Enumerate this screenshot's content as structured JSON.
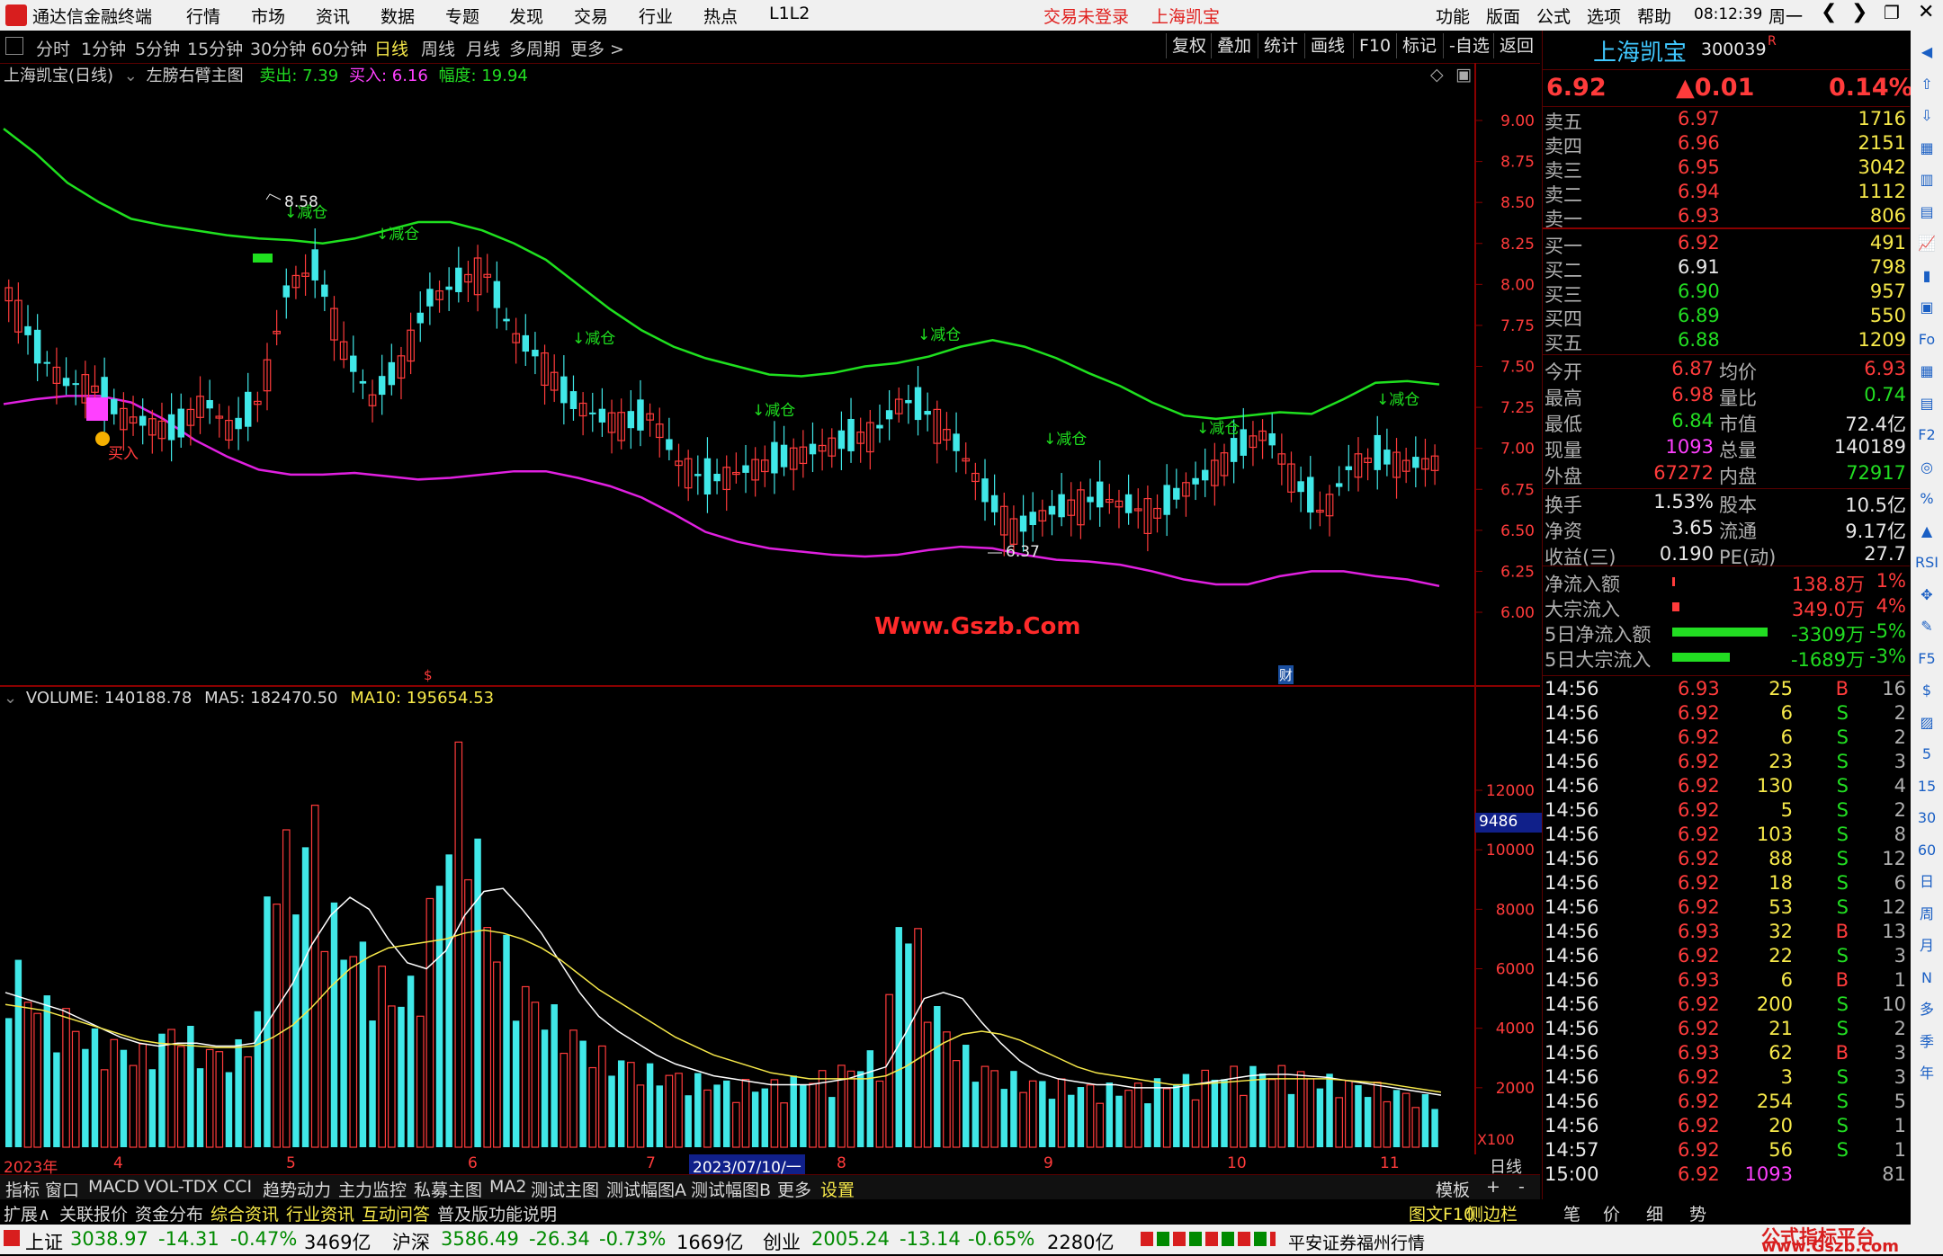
{
  "titlebar": {
    "app_title": "通达信金融终端",
    "menus": [
      "行情",
      "市场",
      "资讯",
      "数据",
      "专题",
      "发现",
      "交易",
      "行业",
      "热点",
      "L1L2"
    ],
    "login_status": "交易未登录",
    "stock_name": "上海凯宝",
    "right_menus": [
      "功能",
      "版面",
      "公式",
      "选项",
      "帮助"
    ],
    "clock": "08:12:39",
    "weekday": "周一"
  },
  "toolbar": {
    "periods": [
      "分时",
      "1分钟",
      "5分钟",
      "15分钟",
      "30分钟",
      "60分钟",
      "日线",
      "周线",
      "月线",
      "多周期",
      "更多 >"
    ],
    "selected": "日线",
    "buttons": [
      "复权",
      "叠加",
      "统计",
      "画线",
      "F10",
      "标记",
      "-自选",
      "返回"
    ]
  },
  "main_header": {
    "name": "上海凯宝(日线)",
    "formula": "左膀右臂主图",
    "sell_label": "卖出: 7.39",
    "buy_label": "买入: 6.16",
    "range_label": "幅度: 19.94"
  },
  "main_chart": {
    "y_ticks": [
      "9.00",
      "8.75",
      "8.50",
      "8.25",
      "8.00",
      "7.75",
      "7.50",
      "7.25",
      "7.00",
      "6.75",
      "6.50",
      "6.25",
      "6.00"
    ],
    "annotations": {
      "high": "8.58",
      "low": "6.37",
      "reduce": "减仓",
      "buy": "买入",
      "watermark": "Www.Gszb.Com",
      "dollar": "$",
      "fin": "财"
    }
  },
  "volume_header": {
    "volume": "VOLUME: 140188.78",
    "ma5": "MA5: 182470.50",
    "ma10": "MA10: 195654.53"
  },
  "volume_chart": {
    "y_ticks": [
      "12000",
      "10000",
      "8000",
      "6000",
      "4000",
      "2000"
    ],
    "cursor_value": "9486",
    "unit": "X100"
  },
  "x_axis": {
    "labels": [
      "2023年",
      "4",
      "5",
      "6",
      "7",
      "8",
      "9",
      "10",
      "11"
    ],
    "highlight": "2023/07/10/一",
    "right_label": "日线"
  },
  "quote": {
    "name": "上海凯宝",
    "code": "300039",
    "flag": "R",
    "price": "6.92",
    "change": "▲0.01",
    "pct": "0.14%",
    "asks": [
      {
        "label": "卖五",
        "price": "6.97",
        "vol": "1716"
      },
      {
        "label": "卖四",
        "price": "6.96",
        "vol": "2151"
      },
      {
        "label": "卖三",
        "price": "6.95",
        "vol": "3042"
      },
      {
        "label": "卖二",
        "price": "6.94",
        "vol": "1112"
      },
      {
        "label": "卖一",
        "price": "6.93",
        "vol": "806"
      }
    ],
    "bids": [
      {
        "label": "买一",
        "price": "6.92",
        "vol": "491"
      },
      {
        "label": "买二",
        "price": "6.91",
        "vol": "798"
      },
      {
        "label": "买三",
        "price": "6.90",
        "vol": "957"
      },
      {
        "label": "买四",
        "price": "6.89",
        "vol": "550"
      },
      {
        "label": "买五",
        "price": "6.88",
        "vol": "1209"
      }
    ],
    "stats": [
      {
        "l1": "今开",
        "v1": "6.87",
        "l2": "均价",
        "v2": "6.93"
      },
      {
        "l1": "最高",
        "v1": "6.98",
        "l2": "量比",
        "v2": "0.74"
      },
      {
        "l1": "最低",
        "v1": "6.84",
        "l2": "市值",
        "v2": "72.4亿"
      },
      {
        "l1": "现量",
        "v1": "1093",
        "l2": "总量",
        "v2": "140189"
      },
      {
        "l1": "外盘",
        "v1": "67272",
        "l2": "内盘",
        "v2": "72917"
      }
    ],
    "stats2": [
      {
        "l1": "换手",
        "v1": "1.53%",
        "l2": "股本",
        "v2": "10.5亿"
      },
      {
        "l1": "净资",
        "v1": "3.65",
        "l2": "流通",
        "v2": "9.17亿"
      },
      {
        "l1": "收益(三)",
        "v1": "0.190",
        "l2": "PE(动)",
        "v2": "27.7"
      }
    ],
    "flows": [
      {
        "label": "净流入额",
        "value": "138.8万",
        "pct": "1%",
        "bar": 0.02
      },
      {
        "label": "大宗流入",
        "value": "349.0万",
        "pct": "4%",
        "bar": 0.08
      },
      {
        "label": "5日净流入额",
        "value": "-3309万",
        "pct": "-5%",
        "bar": 1.0
      },
      {
        "label": "5日大宗流入",
        "value": "-1689万",
        "pct": "-3%",
        "bar": 0.6
      }
    ],
    "ticks": [
      [
        "14:56",
        "6.93",
        "25",
        "B",
        "16"
      ],
      [
        "14:56",
        "6.92",
        "6",
        "S",
        "2"
      ],
      [
        "14:56",
        "6.92",
        "6",
        "S",
        "2"
      ],
      [
        "14:56",
        "6.92",
        "23",
        "S",
        "3"
      ],
      [
        "14:56",
        "6.92",
        "130",
        "S",
        "4"
      ],
      [
        "14:56",
        "6.92",
        "5",
        "S",
        "2"
      ],
      [
        "14:56",
        "6.92",
        "103",
        "S",
        "8"
      ],
      [
        "14:56",
        "6.92",
        "88",
        "S",
        "12"
      ],
      [
        "14:56",
        "6.92",
        "18",
        "S",
        "6"
      ],
      [
        "14:56",
        "6.92",
        "53",
        "S",
        "12"
      ],
      [
        "14:56",
        "6.93",
        "32",
        "B",
        "13"
      ],
      [
        "14:56",
        "6.92",
        "22",
        "S",
        "3"
      ],
      [
        "14:56",
        "6.93",
        "6",
        "B",
        "1"
      ],
      [
        "14:56",
        "6.92",
        "200",
        "S",
        "10"
      ],
      [
        "14:56",
        "6.92",
        "21",
        "S",
        "2"
      ],
      [
        "14:56",
        "6.93",
        "62",
        "B",
        "3"
      ],
      [
        "14:56",
        "6.92",
        "3",
        "S",
        "3"
      ],
      [
        "14:56",
        "6.92",
        "254",
        "S",
        "5"
      ],
      [
        "14:56",
        "6.92",
        "20",
        "S",
        "1"
      ],
      [
        "14:57",
        "6.92",
        "56",
        "S",
        "1"
      ],
      [
        "15:00",
        "6.92",
        "1093",
        "",
        "81"
      ]
    ]
  },
  "tabs1": [
    "指标",
    "窗口",
    "MACD",
    "VOL-TDX",
    "CCI",
    "趋势动力",
    "主力监控",
    "私募主图",
    "MA2",
    "测试主图",
    "测试幅图A",
    "测试幅图B",
    "更多",
    "设置"
  ],
  "tabs1_right": [
    "模板",
    "+",
    "-"
  ],
  "tabs2": [
    "扩展∧",
    "关联报价",
    "资金分布",
    "综合资讯",
    "行业资讯",
    "互动问答",
    "普及版功能说明"
  ],
  "tabs2_right": [
    "图文F10",
    "侧边栏 《"
  ],
  "bottom_tabs": [
    "笔",
    "价",
    "细",
    "势"
  ],
  "iconbar": [
    "◀",
    "⇧",
    "⇩",
    "▦",
    "▥",
    "▤",
    "📈",
    "▮",
    "▣",
    "Fo",
    "▦",
    "▤",
    "F2",
    "◎",
    "%",
    "▲",
    "RSI",
    "✥",
    "✎",
    "F5",
    "$",
    "▨",
    "5",
    "15",
    "30",
    "60",
    "日",
    "周",
    "月",
    "N",
    "多",
    "季",
    "年"
  ],
  "statusbar": {
    "sh_name": "上证",
    "sh_val": "3038.97",
    "sh_chg": "-14.31",
    "sh_pct": "-0.47%",
    "sh_amt": "3469亿",
    "hs_name": "沪深",
    "hs_val": "3586.49",
    "hs_chg": "-26.34",
    "hs_pct": "-0.73%",
    "hs_amt": "1669亿",
    "cy_name": "创业",
    "cy_val": "2005.24",
    "cy_chg": "-13.14",
    "cy_pct": "-0.65%",
    "cy_amt": "2280亿",
    "broker": "平安证券福州行情",
    "brand1": "公式指标平台",
    "brand2": "www.Gszb.com"
  },
  "chart_data": [
    {
      "type": "candlestick",
      "title": "上海凯宝(日线)",
      "ylim": [
        5.8,
        9.2
      ],
      "y_ticks": [
        6.0,
        6.25,
        6.5,
        6.75,
        7.0,
        7.25,
        7.5,
        7.75,
        8.0,
        8.25,
        8.5,
        8.75,
        9.0
      ],
      "series": [
        {
          "name": "green_band",
          "values": [
            8.95,
            8.8,
            8.62,
            8.5,
            8.4,
            8.36,
            8.33,
            8.3,
            8.28,
            8.27,
            8.25,
            8.28,
            8.33,
            8.38,
            8.38,
            8.33,
            8.25,
            8.15,
            8.0,
            7.85,
            7.72,
            7.62,
            7.55,
            7.5,
            7.45,
            7.44,
            7.46,
            7.5,
            7.52,
            7.56,
            7.62,
            7.66,
            7.62,
            7.55,
            7.46,
            7.38,
            7.28,
            7.2,
            7.18,
            7.2,
            7.22,
            7.21,
            7.3,
            7.4,
            7.41,
            7.39
          ]
        },
        {
          "name": "magenta_band",
          "values": [
            7.27,
            7.3,
            7.32,
            7.32,
            7.28,
            7.18,
            7.05,
            6.95,
            6.87,
            6.84,
            6.84,
            6.85,
            6.83,
            6.81,
            6.82,
            6.84,
            6.86,
            6.86,
            6.82,
            6.77,
            6.7,
            6.6,
            6.49,
            6.43,
            6.39,
            6.37,
            6.35,
            6.34,
            6.35,
            6.38,
            6.4,
            6.39,
            6.35,
            6.32,
            6.31,
            6.29,
            6.25,
            6.2,
            6.17,
            6.17,
            6.22,
            6.25,
            6.25,
            6.22,
            6.2,
            6.16
          ]
        },
        {
          "name": "close",
          "values": [
            7.95,
            7.6,
            7.4,
            7.38,
            7.2,
            7.15,
            7.1,
            7.3,
            7.1,
            7.3,
            8.0,
            8.1,
            7.6,
            7.3,
            7.5,
            7.9,
            8.0,
            8.1,
            7.7,
            7.55,
            7.3,
            7.2,
            7.15,
            7.2,
            6.9,
            6.8,
            6.85,
            6.9,
            6.95,
            7.0,
            7.05,
            7.1,
            7.3,
            7.2,
            7.0,
            6.7,
            6.5,
            6.6,
            6.65,
            6.7,
            6.65,
            6.6,
            6.75,
            6.85,
            7.0,
            7.1,
            6.8,
            6.6,
            6.9,
            6.95,
            6.9,
            6.92
          ]
        }
      ],
      "annotations": {
        "high": 8.58,
        "low": 6.37
      }
    },
    {
      "type": "bar",
      "title": "VOLUME",
      "ylim": [
        0,
        13000
      ],
      "y_ticks": [
        2000,
        4000,
        6000,
        8000,
        10000,
        12000
      ],
      "series": [
        {
          "name": "volume",
          "values": [
            6200,
            5000,
            4500,
            4200,
            3600,
            3400,
            3200,
            3000,
            3500,
            4000,
            3200,
            3000,
            3100,
            3800,
            10500,
            8500,
            10800,
            7300,
            6500,
            6000,
            5000,
            4800,
            7000,
            10000,
            13000,
            7500,
            6500,
            5000,
            4600,
            4000,
            3500,
            3000,
            2800,
            2600,
            2400,
            2300,
            2200,
            2100,
            2000,
            2000,
            2000,
            2100,
            2200,
            2300,
            2500,
            2800,
            3000,
            8300,
            6000,
            4000,
            3200,
            2600,
            2400,
            2200,
            2100,
            2000,
            2000,
            1900,
            1900,
            1900,
            2000,
            2100,
            2200,
            2300,
            2400,
            2400,
            2500,
            2400,
            2300,
            2200,
            2100,
            2000,
            1900,
            1800,
            1600,
            1500
          ]
        },
        {
          "name": "MA5",
          "values": [
            5200,
            5000,
            4800,
            4600,
            4300,
            4000,
            3700,
            3500,
            3400,
            3500,
            3500,
            3400,
            3400,
            3500,
            4500,
            5500,
            6800,
            7800,
            8400,
            8000,
            7000,
            6200,
            6000,
            6600,
            7800,
            8600,
            8700,
            8000,
            7200,
            6200,
            5200,
            4400,
            3900,
            3500,
            3100,
            2800,
            2600,
            2400,
            2300,
            2200,
            2100,
            2100,
            2100,
            2200,
            2300,
            2500,
            2700,
            3800,
            5000,
            5200,
            5000,
            4200,
            3500,
            2900,
            2500,
            2300,
            2200,
            2100,
            2100,
            2000,
            2000,
            2000,
            2100,
            2200,
            2300,
            2400,
            2450,
            2450,
            2400,
            2350,
            2250,
            2150,
            2050,
            1950,
            1850,
            1750
          ]
        },
        {
          "name": "MA10",
          "values": [
            4800,
            4700,
            4600,
            4400,
            4200,
            4000,
            3800,
            3600,
            3500,
            3450,
            3400,
            3350,
            3350,
            3400,
            3700,
            4100,
            4700,
            5400,
            6000,
            6400,
            6700,
            6800,
            6900,
            7000,
            7200,
            7300,
            7200,
            7000,
            6700,
            6300,
            5800,
            5300,
            4900,
            4500,
            4100,
            3700,
            3400,
            3100,
            2900,
            2700,
            2500,
            2400,
            2300,
            2300,
            2300,
            2300,
            2400,
            2700,
            3100,
            3500,
            3800,
            3900,
            3800,
            3600,
            3300,
            3000,
            2700,
            2500,
            2400,
            2300,
            2200,
            2100,
            2100,
            2150,
            2200,
            2250,
            2300,
            2300,
            2300,
            2300,
            2250,
            2200,
            2150,
            2050,
            1950,
            1850
          ]
        }
      ]
    }
  ]
}
